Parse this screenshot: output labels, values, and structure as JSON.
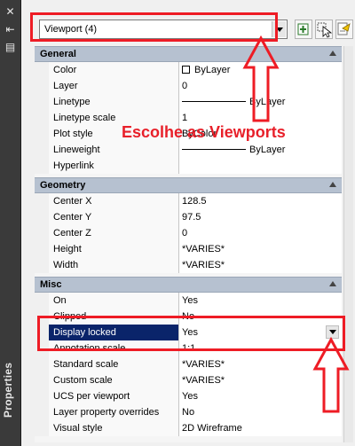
{
  "palette": {
    "annotation": "#ee1c25",
    "section_header_bg": "#b6c1d0",
    "selection_bg": "#0a246a"
  },
  "left_strip": {
    "title": "Properties",
    "icons": [
      "close-icon",
      "auto-hide-icon",
      "properties-menu-icon"
    ]
  },
  "selector": {
    "value": "Viewport (4)",
    "arrow_icon": "chevron-down-icon"
  },
  "toolbar": {
    "buttons": [
      "toggle-pickadd-icon",
      "select-objects-icon",
      "quick-select-icon"
    ]
  },
  "annotation_text": "Escolhe as Viewports",
  "sections": {
    "general": {
      "title": "General",
      "rows": [
        {
          "name": "Color",
          "value": "ByLayer"
        },
        {
          "name": "Layer",
          "value": "0"
        },
        {
          "name": "Linetype",
          "value": "ByLayer"
        },
        {
          "name": "Linetype scale",
          "value": "1"
        },
        {
          "name": "Plot style",
          "value": "ByColor"
        },
        {
          "name": "Lineweight",
          "value": "ByLayer"
        },
        {
          "name": "Hyperlink",
          "value": ""
        }
      ]
    },
    "geometry": {
      "title": "Geometry",
      "rows": [
        {
          "name": "Center X",
          "value": "128.5"
        },
        {
          "name": "Center Y",
          "value": "97.5"
        },
        {
          "name": "Center Z",
          "value": "0"
        },
        {
          "name": "Height",
          "value": "*VARIES*"
        },
        {
          "name": "Width",
          "value": "*VARIES*"
        }
      ]
    },
    "misc": {
      "title": "Misc",
      "rows": [
        {
          "name": "On",
          "value": "Yes"
        },
        {
          "name": "Clipped",
          "value": "No"
        },
        {
          "name": "Display locked",
          "value": "Yes"
        },
        {
          "name": "Annotation scale",
          "value": "1:1"
        },
        {
          "name": "Standard scale",
          "value": "*VARIES*"
        },
        {
          "name": "Custom scale",
          "value": "*VARIES*"
        },
        {
          "name": "UCS per viewport",
          "value": "Yes"
        },
        {
          "name": "Layer property overrides",
          "value": "No"
        },
        {
          "name": "Visual style",
          "value": "2D Wireframe"
        }
      ]
    }
  }
}
